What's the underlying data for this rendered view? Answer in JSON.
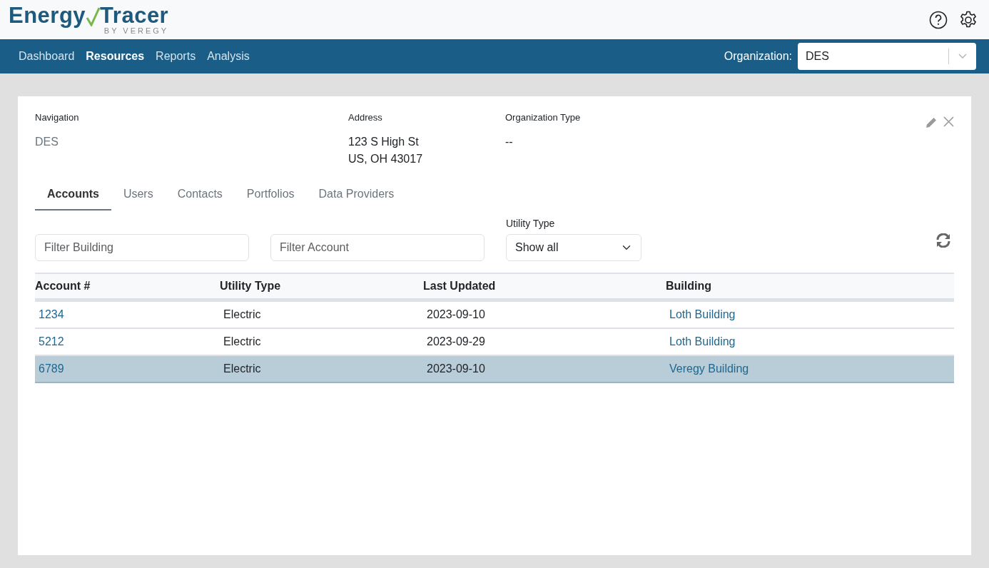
{
  "logo": {
    "word_1": "Energy",
    "word_2": "Tracer",
    "tagline": "BY VEREGY"
  },
  "nav": [
    {
      "label": "Dashboard",
      "selected": false
    },
    {
      "label": "Resources",
      "selected": true
    },
    {
      "label": "Reports",
      "selected": false
    },
    {
      "label": "Analysis",
      "selected": false
    }
  ],
  "organization": {
    "label": "Organization:",
    "value": "DES"
  },
  "details": [
    {
      "label": "Navigation",
      "lines": [
        "DES"
      ],
      "kind": "muted"
    },
    {
      "label": "Address",
      "lines": [
        "123 S High St",
        "US, OH 43017"
      ],
      "kind": "plain"
    },
    {
      "label": "Organization Type",
      "lines": [
        "--"
      ],
      "kind": "plain"
    }
  ],
  "tabs": [
    {
      "label": "Accounts",
      "selected": true
    },
    {
      "label": "Users",
      "selected": false
    },
    {
      "label": "Contacts",
      "selected": false
    },
    {
      "label": "Portfolios",
      "selected": false
    },
    {
      "label": "Data Providers",
      "selected": false
    }
  ],
  "filters": {
    "building_placeholder": "Filter Building",
    "account_placeholder": "Filter Account",
    "utility_label": "Utility Type",
    "utility_value": "Show all"
  },
  "table": {
    "columns": [
      "Account #",
      "Utility Type",
      "Last Updated",
      "Building"
    ],
    "rows": [
      {
        "cells": [
          "1234",
          "Electric",
          "2023-09-10",
          "Loth Building"
        ],
        "selected": false
      },
      {
        "cells": [
          "5212",
          "Electric",
          "2023-09-29",
          "Loth Building"
        ],
        "selected": false
      },
      {
        "cells": [
          "6789",
          "Electric",
          "2023-09-10",
          "Veregy Building"
        ],
        "selected": true
      }
    ]
  }
}
